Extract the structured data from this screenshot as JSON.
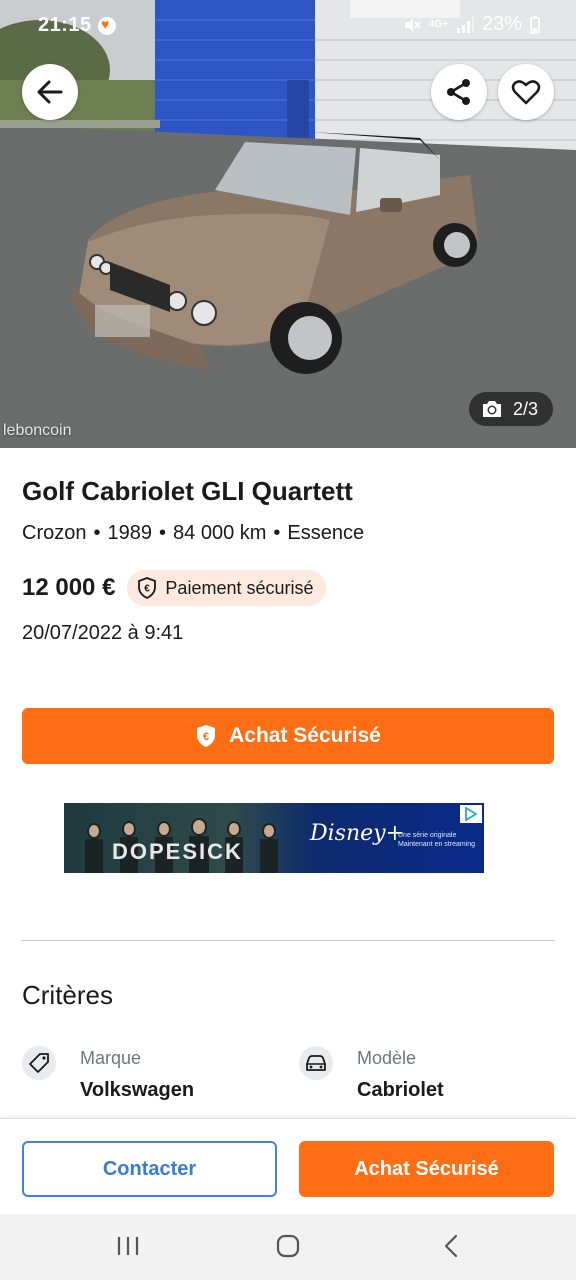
{
  "status_bar": {
    "time": "21:15",
    "battery": "23%",
    "network": "4G+"
  },
  "photo": {
    "counter": "2/3",
    "watermark": "leboncoin",
    "icons": {
      "back": "arrow-left-icon",
      "share": "share-icon",
      "favorite": "heart-icon",
      "camera": "camera-icon"
    }
  },
  "listing": {
    "title": "Golf Cabriolet GLI Quartett",
    "meta": [
      "Crozon",
      "1989",
      "84 000 km",
      "Essence"
    ],
    "meta_separator": "•",
    "price": "12 000 €",
    "payment_badge": "Paiement sécurisé",
    "date": "20/07/2022 à 9:41",
    "cta_label": "Achat Sécurisé"
  },
  "ad": {
    "show_title": "DOPESICK",
    "brand": "Disney+",
    "tagline": "Une série originale Maintenant en streaming"
  },
  "criteria": {
    "title": "Critères",
    "items": [
      {
        "label": "Marque",
        "value": "Volkswagen",
        "icon": "tag-icon"
      },
      {
        "label": "Modèle",
        "value": "Cabriolet",
        "icon": "car-icon"
      }
    ]
  },
  "action_bar": {
    "contact_label": "Contacter",
    "buy_label": "Achat Sécurisé"
  },
  "colors": {
    "accent": "#ff6e14",
    "link_blue": "#3a7bd5",
    "badge_bg": "#fde9df"
  }
}
